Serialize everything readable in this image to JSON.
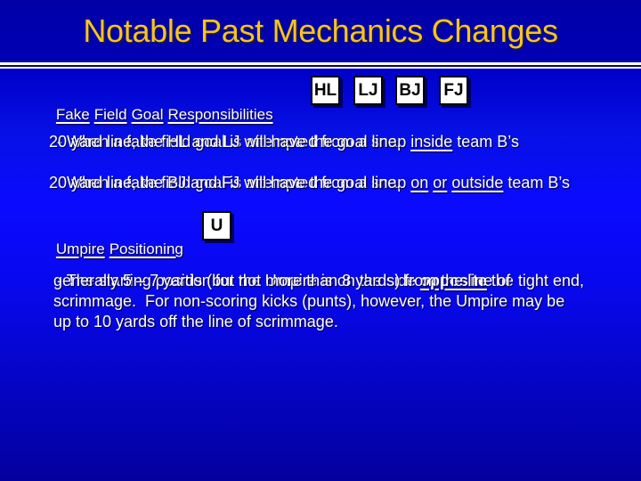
{
  "title": "Notable Past Mechanics Changes",
  "colors": {
    "title": "#f6c421",
    "text": "#ffffff",
    "badge_bg": "#ffffff",
    "badge_border": "#000000",
    "background_top": "#0000a6",
    "background_mid": "#0a0aff",
    "background_bottom": "#04009e"
  },
  "section1": {
    "heading_words": [
      "Fake",
      "Field",
      "Goal",
      "Responsibilities"
    ],
    "badges": [
      "HL",
      "LJ",
      "BJ",
      "FJ"
    ],
    "lines": [
      {
        "pre": "- When a fake field goal is attempted from a snap ",
        "u1": "inside",
        "post": " team B’s"
      },
      {
        "text": "20 yard line, the HL and LJ will have the goal line."
      },
      {
        "pre": "When a fake field goal is attempted from a snap ",
        "u1": "on",
        "mid1": " ",
        "u2": "or",
        "mid2": " ",
        "u3": "outside",
        "post": " team B’s"
      },
      {
        "text": "20 yard line, the BJ and FJ will have the goal line."
      }
    ]
  },
  "section2": {
    "heading_words": [
      "Umpire",
      "Positioning"
    ],
    "badges": [
      "U"
    ],
    "lines": [
      {
        "pre": "- The starting position for the Umpire is on the side ",
        "bu": "opposite",
        "post": " the tight end,"
      },
      {
        "text": "generally 5 – 7 yards (but not more than 8 yards) from the line of"
      },
      {
        "text": "scrimmage.  For non-scoring kicks (punts), however, the Umpire may be"
      },
      {
        "text": "up to 10 yards off the line of scrimmage."
      }
    ]
  }
}
